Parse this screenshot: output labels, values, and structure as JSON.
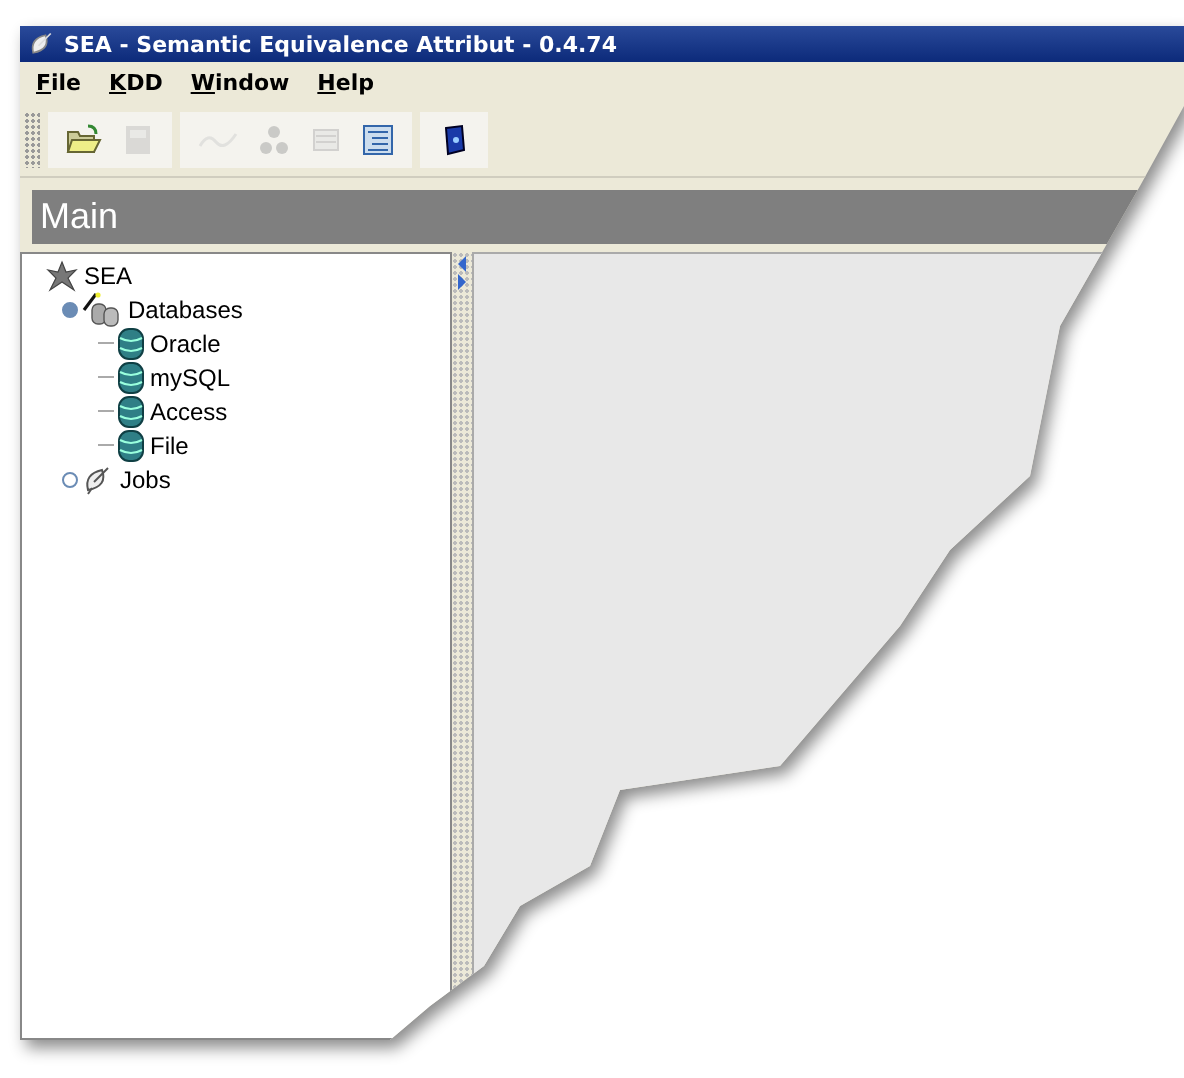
{
  "window": {
    "title": "SEA - Semantic Equivalence Attribut - 0.4.74"
  },
  "menu": [
    {
      "label": "File"
    },
    {
      "label": "KDD"
    },
    {
      "label": "Window"
    },
    {
      "label": "Help"
    }
  ],
  "toolbar": [
    {
      "kind": "open",
      "disabled": false
    },
    {
      "kind": "save",
      "disabled": true
    },
    {
      "kind": "wave",
      "disabled": true
    },
    {
      "kind": "cluster",
      "disabled": true
    },
    {
      "kind": "list",
      "disabled": true
    },
    {
      "kind": "form",
      "disabled": false
    },
    {
      "kind": "book",
      "disabled": false
    }
  ],
  "panel": {
    "title": "Main"
  },
  "tree": {
    "label": "SEA",
    "kind": "root",
    "children": [
      {
        "label": "Databases",
        "kind": "databases",
        "expanded": true,
        "children": [
          {
            "label": "Oracle",
            "kind": "database"
          },
          {
            "label": "mySQL",
            "kind": "database"
          },
          {
            "label": "Access",
            "kind": "database"
          },
          {
            "label": "File",
            "kind": "database"
          }
        ]
      },
      {
        "label": "Jobs",
        "kind": "jobs",
        "expanded": false
      }
    ]
  }
}
